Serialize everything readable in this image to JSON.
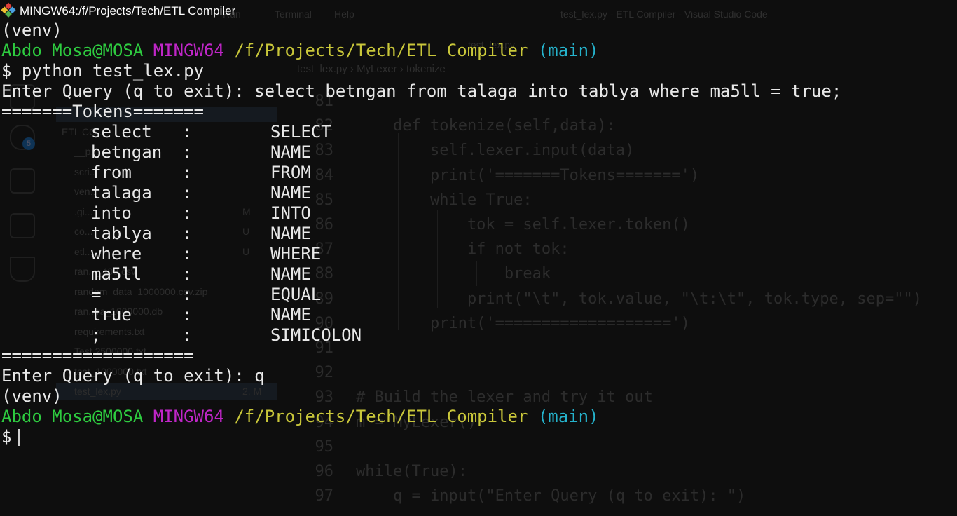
{
  "window": {
    "title": "MINGW64:/f/Projects/Tech/ETL Compiler"
  },
  "terminal": {
    "venv": "(venv)",
    "prompt": {
      "user": "Abdo Mosa@MOSA",
      "system": "MINGW64",
      "path": "/f/Projects/Tech/ETL Compiler",
      "branch": "(main)",
      "symbol": "$"
    },
    "command": "$ python test_lex.py",
    "query_line_1": "Enter Query (q to exit): select betngan from talaga into tablya where ma5ll = true;",
    "tokens_header": "=======Tokens=======",
    "tokens": [
      {
        "value": "select",
        "sep": ":",
        "type": "SELECT"
      },
      {
        "value": "betngan",
        "sep": ":",
        "type": "NAME"
      },
      {
        "value": "from",
        "sep": ":",
        "type": "FROM"
      },
      {
        "value": "talaga",
        "sep": ":",
        "type": "NAME"
      },
      {
        "value": "into",
        "sep": ":",
        "type": "INTO"
      },
      {
        "value": "tablya",
        "sep": ":",
        "type": "NAME"
      },
      {
        "value": "where",
        "sep": ":",
        "type": "WHERE"
      },
      {
        "value": "ma5ll",
        "sep": ":",
        "type": "NAME"
      },
      {
        "value": "=",
        "sep": ":",
        "type": "EQUAL"
      },
      {
        "value": "true",
        "sep": ":",
        "type": "NAME"
      },
      {
        "value": ";",
        "sep": ":",
        "type": "SIMICOLON"
      }
    ],
    "tokens_footer": "===================",
    "query_line_2": "Enter Query (q to exit): q",
    "colors": {
      "user": "#2ecc40",
      "system": "#c026c8",
      "path": "#c9c73a",
      "branch": "#25b3cc"
    }
  },
  "background_editor": {
    "menu": [
      "Run",
      "Terminal",
      "Help"
    ],
    "title": "test_lex.py - ETL Compiler - Visual Studio Code",
    "tab": "test_lex.py",
    "breadcrumb": [
      "test_lex.py",
      "MyLexer",
      "tokenize"
    ],
    "source_control_badge": "5",
    "explorer": {
      "section": "ETL CO...",
      "items": [
        {
          "name": "__p...",
          "status": ""
        },
        {
          "name": "scri...",
          "status": ""
        },
        {
          "name": "ven...",
          "status": ""
        },
        {
          "name": ".gi...",
          "status": "M"
        },
        {
          "name": "co...",
          "status": "U"
        },
        {
          "name": "etl...",
          "status": "U"
        },
        {
          "name": "ran..._400.csv",
          "status": ""
        },
        {
          "name": "random_data_1000000.csv.zip",
          "status": ""
        },
        {
          "name": "ran...ra_1000000.db",
          "status": ""
        },
        {
          "name": "requirements.txt",
          "status": ""
        },
        {
          "name": "Test 2500000.txt",
          "status": ""
        },
        {
          "name": "test_1000000.txt",
          "status": ""
        },
        {
          "name": "test_lex.py",
          "status": "2, M"
        }
      ]
    },
    "code_lines": [
      {
        "num": "81",
        "text": ""
      },
      {
        "num": "82",
        "text": "    def tokenize(self,data):"
      },
      {
        "num": "83",
        "text": "        self.lexer.input(data)"
      },
      {
        "num": "84",
        "text": "        print('=======Tokens=======')"
      },
      {
        "num": "85",
        "text": "        while True:"
      },
      {
        "num": "86",
        "text": "            tok = self.lexer.token()"
      },
      {
        "num": "87",
        "text": "            if not tok:"
      },
      {
        "num": "88",
        "text": "                break"
      },
      {
        "num": "89",
        "text": "            print(\"\\t\", tok.value, \"\\t:\\t\", tok.type, sep=\"\")"
      },
      {
        "num": "90",
        "text": "        print('===================')"
      },
      {
        "num": "91",
        "text": ""
      },
      {
        "num": "92",
        "text": ""
      },
      {
        "num": "93",
        "text": "# Build the lexer and try it out"
      },
      {
        "num": "94",
        "text": "m = MyLexer()"
      },
      {
        "num": "95",
        "text": ""
      },
      {
        "num": "96",
        "text": "while(True):"
      },
      {
        "num": "97",
        "text": "    q = input(\"Enter Query (q to exit): \")"
      }
    ]
  }
}
